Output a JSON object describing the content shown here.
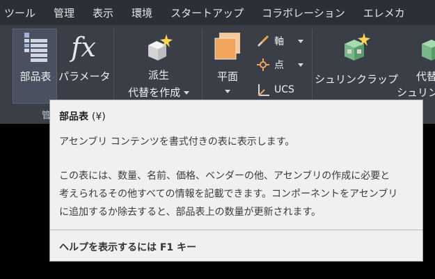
{
  "menu": [
    "ツール",
    "管理",
    "表示",
    "環境",
    "スタートアップ",
    "コラボレーション",
    "エレメカ"
  ],
  "ribbon": {
    "bom_label": "部品表",
    "param_label": "パラメータ",
    "derive_line1": "派生",
    "derive_line2": "代替を作成",
    "plane_label": "平面",
    "axis_label": "軸",
    "point_label": "点",
    "ucs_label": "UCS",
    "shrinkwrap_label": "シュリンクラップ",
    "substitute_line1": "代替",
    "substitute_line2": "シュリン",
    "group_label": "管"
  },
  "tooltip": {
    "title": "部品表",
    "shortcut": "(¥)",
    "description": "アセンブリ コンテンツを書式付きの表に表示します。",
    "body_lines": [
      "この表には、数量、名前、価格、ベンダーの他、アセンブリの作成に必要と",
      "考えられるその他すべての情報を記載できます。コンポーネントをアセンブリ",
      "に追加するか除去すると、部品表上の数量が更新されます。"
    ],
    "help": "ヘルプを表示するには F1 キー"
  },
  "colors": {
    "menubar": "#2b2f36",
    "ribbon": "#3a3f47",
    "tooltip_bg": "#f0f0f0",
    "accent_orange": "#f2a35c",
    "accent_yellow": "#ffd35a",
    "green_icon": "#77b889"
  },
  "icons": [
    "bom-icon",
    "parameters-icon",
    "derive-icon",
    "plane-icon",
    "axis-icon",
    "point-icon",
    "ucs-icon",
    "shrinkwrap-icon",
    "substitute-icon"
  ]
}
